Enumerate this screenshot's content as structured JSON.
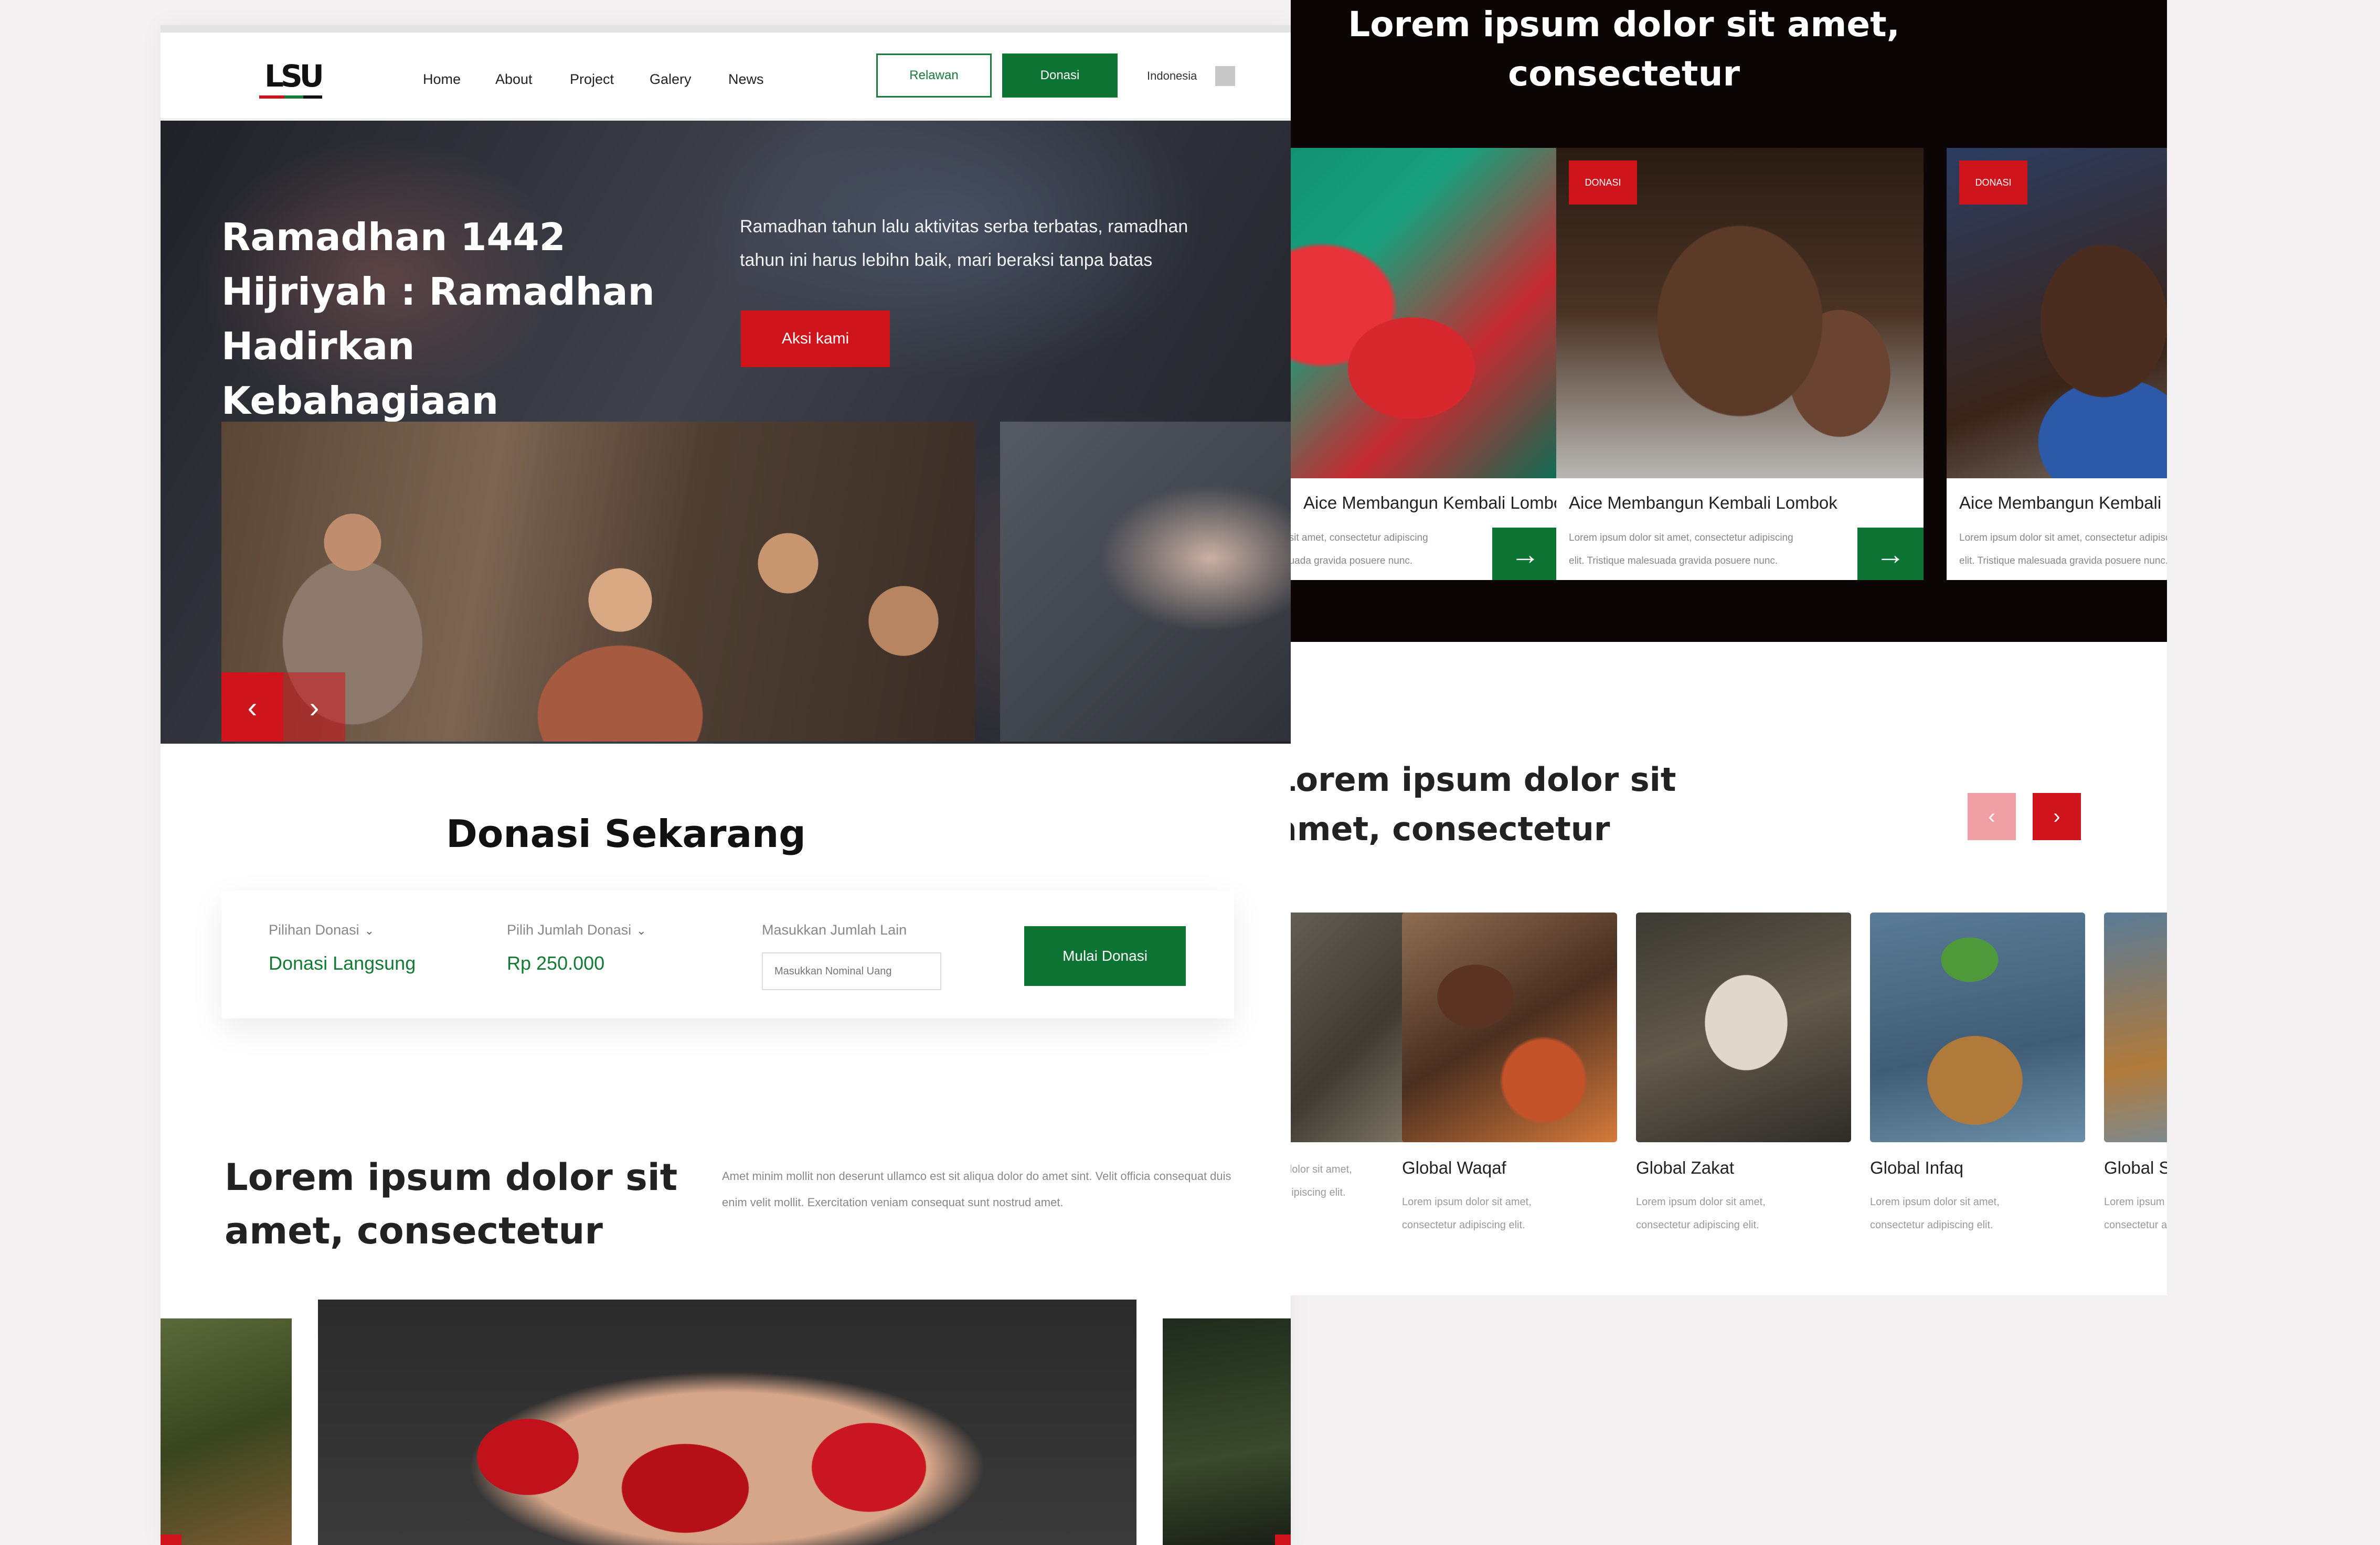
{
  "nav": {
    "logo_text": "LSU",
    "items": [
      "Home",
      "About",
      "Project",
      "Galery",
      "News"
    ],
    "relawan_label": "Relawan",
    "donasi_label": "Donasi",
    "language": "Indonesia"
  },
  "hero": {
    "title": "Ramadhan 1442 Hijriyah : Ramadhan Hadirkan Kebahagiaan",
    "description": "Ramadhan tahun lalu aktivitas serba terbatas, ramadhan tahun ini harus lebihn baik, mari beraksi tanpa batas",
    "cta_label": "Aksi kami",
    "prev_icon": "‹",
    "next_icon": "›"
  },
  "donasi": {
    "title": "Donasi Sekarang",
    "pilihan_label": "Pilihan Donasi",
    "pilihan_value": "Donasi Langsung",
    "jumlah_label": "Pilih Jumlah Donasi",
    "jumlah_value": "Rp 250.000",
    "lain_label": "Masukkan Jumlah Lain",
    "lain_placeholder": "Masukkan Nominal Uang",
    "cta_label": "Mulai Donasi"
  },
  "about": {
    "title": "Lorem ipsum dolor sit amet, consectetur",
    "text": "Amet minim mollit non deserunt ullamco est sit aliqua dolor do amet sint. Velit officia consequat duis enim velit mollit. Exercitation veniam consequat sunt nostrud amet."
  },
  "campaign": {
    "title": "Lorem ipsum dolor sit amet, consectetur",
    "cards": [
      {
        "tag": "",
        "title": "Aice Membangun Kembali Lombok",
        "desc": "Lorem ipsum dolor sit amet, consectetur adipiscing elit. Tristique malesuada gravida posuere nunc."
      },
      {
        "tag": "DONASI",
        "title": "Aice Membangun Kembali Lombok",
        "desc": "Lorem ipsum dolor sit amet, consectetur adipiscing elit. Tristique malesuada gravida posuere nunc."
      },
      {
        "tag": "DONASI",
        "title": "Aice Membangun Kembali Lombok",
        "desc": "Lorem ipsum dolor sit amet, consectetur adipiscing elit. Tristique malesuada gravida posuere nunc."
      }
    ],
    "arrow_icon": "→"
  },
  "programs": {
    "title": "Lorem ipsum dolor sit amet, consectetur",
    "prev_icon": "‹",
    "next_icon": "›",
    "items": [
      {
        "title": "",
        "desc": "Lorem ipsum dolor sit amet, consectetur adipiscing elit."
      },
      {
        "title": "Global Waqaf",
        "desc": "Lorem ipsum dolor sit amet, consectetur adipiscing elit."
      },
      {
        "title": "Global Zakat",
        "desc": "Lorem ipsum dolor sit amet, consectetur adipiscing elit."
      },
      {
        "title": "Global Infaq",
        "desc": "Lorem ipsum dolor sit amet, consectetur adipiscing elit."
      },
      {
        "title": "Global Sedekah",
        "desc": "Lorem ipsum dolor sit amet, consectetur adipiscing elit."
      }
    ]
  },
  "colors": {
    "brand_red": "#d0141c",
    "brand_green": "#0e7433",
    "dark_bg": "#0b0506",
    "page_bg": "#f4f1f2"
  },
  "icons": [
    "chevron-left-icon",
    "chevron-right-icon",
    "arrow-right-icon",
    "caret-down-icon",
    "flag-icon"
  ]
}
